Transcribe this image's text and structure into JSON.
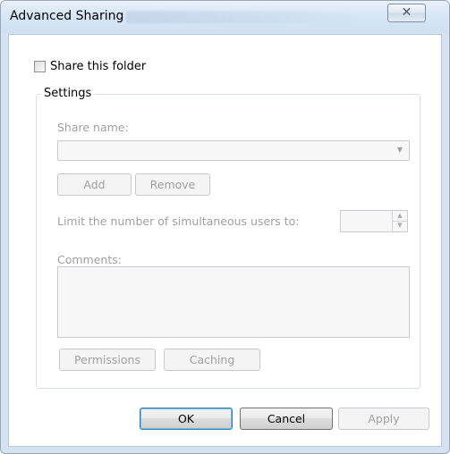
{
  "window": {
    "title": "Advanced Sharing",
    "close_glyph": "✕",
    "close_icon": "close-icon"
  },
  "share": {
    "checkbox_label": "Share this folder",
    "checked": false
  },
  "settings": {
    "group_label": "Settings",
    "share_name_label": "Share name:",
    "share_name_value": "",
    "dropdown_icon": "chevron-down-icon",
    "dropdown_glyph": "▼",
    "add_label": "Add",
    "remove_label": "Remove",
    "limit_label": "Limit the number of simultaneous users to:",
    "limit_value": "",
    "spin_up_glyph": "▲",
    "spin_down_glyph": "▼",
    "comments_label": "Comments:",
    "comments_value": "",
    "permissions_label": "Permissions",
    "caching_label": "Caching"
  },
  "footer": {
    "ok_label": "OK",
    "cancel_label": "Cancel",
    "apply_label": "Apply"
  },
  "colors": {
    "frame": "#d4e2f1",
    "disabled_text": "#a0a0a0",
    "default_button_border": "#3c7fb1"
  }
}
